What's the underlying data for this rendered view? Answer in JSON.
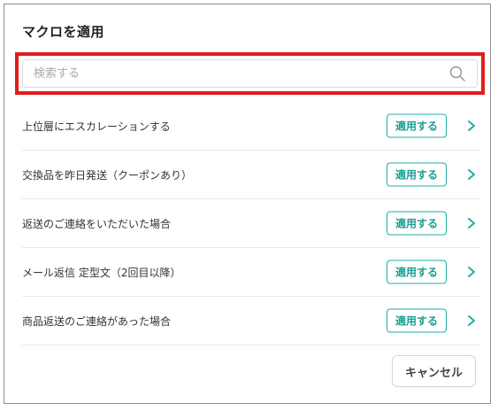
{
  "dialog": {
    "title": "マクロを適用"
  },
  "search": {
    "placeholder": "検索する",
    "value": "",
    "icon": "search-icon"
  },
  "macros": [
    {
      "label": "上位層にエスカレーションする",
      "action_label": "適用する",
      "chevron_icon": "chevron-right-icon"
    },
    {
      "label": "交換品を昨日発送（クーポンあり）",
      "action_label": "適用する",
      "chevron_icon": "chevron-right-icon"
    },
    {
      "label": "返送のご連絡をいただいた場合",
      "action_label": "適用する",
      "chevron_icon": "chevron-right-icon"
    },
    {
      "label": "メール返信 定型文（2回目以降）",
      "action_label": "適用する",
      "chevron_icon": "chevron-right-icon"
    },
    {
      "label": "商品返送のご連絡があった場合",
      "action_label": "適用する",
      "chevron_icon": "chevron-right-icon"
    }
  ],
  "footer": {
    "cancel_label": "キャンセル"
  },
  "colors": {
    "accent": "#1eafa3",
    "highlight": "#e11c1c"
  }
}
